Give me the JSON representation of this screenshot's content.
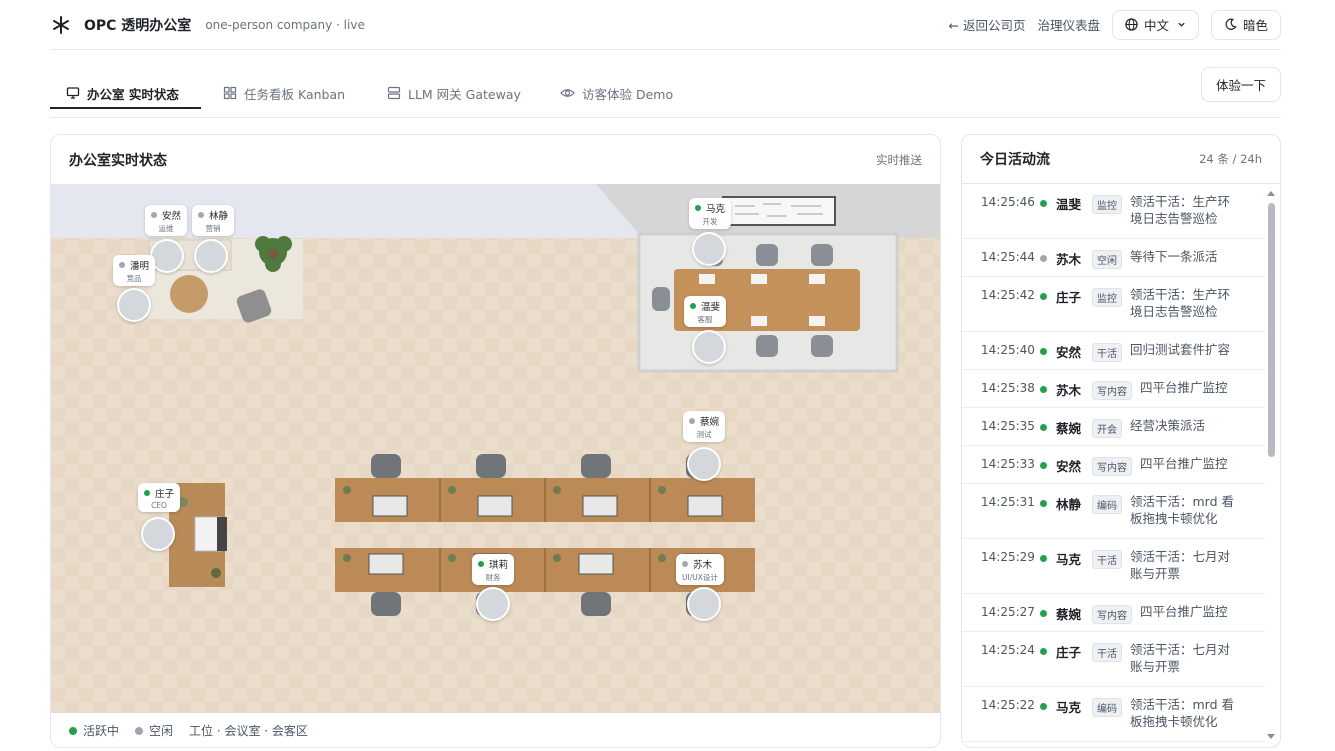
{
  "header": {
    "brand": "OPC 透明办公室",
    "subtitle": "one-person company · live",
    "back_link": "← 返回公司页",
    "governance_link": "治理仪表盘",
    "language": "中文",
    "theme": "暗色"
  },
  "tabs": [
    {
      "label": "办公室  实时状态",
      "icon": "monitor-icon"
    },
    {
      "label": "任务看板  Kanban",
      "icon": "grid-icon"
    },
    {
      "label": "LLM 网关  Gateway",
      "icon": "server-icon"
    },
    {
      "label": "访客体验  Demo",
      "icon": "eye-icon"
    }
  ],
  "try_button": "体验一下",
  "office": {
    "title": "办公室实时状态",
    "tag": "实时推送",
    "legend": {
      "active": "活跃中",
      "idle": "空闲",
      "areas": "工位 · 会议室 · 会客区"
    },
    "people": [
      {
        "name": "安然",
        "role": "运维",
        "status": "idle"
      },
      {
        "name": "林静",
        "role": "营销",
        "status": "idle"
      },
      {
        "name": "潘明",
        "role": "竞品",
        "status": "idle"
      },
      {
        "name": "马克",
        "role": "开发",
        "status": "active"
      },
      {
        "name": "温斐",
        "role": "客服",
        "status": "active"
      },
      {
        "name": "蔡婉",
        "role": "测试",
        "status": "idle"
      },
      {
        "name": "庄子",
        "role": "CEO",
        "status": "active"
      },
      {
        "name": "琪莉",
        "role": "财务",
        "status": "active"
      },
      {
        "name": "苏木",
        "role": "UI/UX设计",
        "status": "idle"
      }
    ]
  },
  "activity": {
    "title": "今日活动流",
    "count": "24 条 / 24h",
    "items": [
      {
        "time": "14:25:46",
        "status": "active",
        "name": "温斐",
        "badge": "监控",
        "text": "领活干活：生产环境日志告警巡检"
      },
      {
        "time": "14:25:44",
        "status": "idle",
        "name": "苏木",
        "badge": "空闲",
        "text": "等待下一条派活"
      },
      {
        "time": "14:25:42",
        "status": "active",
        "name": "庄子",
        "badge": "监控",
        "text": "领活干活：生产环境日志告警巡检"
      },
      {
        "time": "14:25:40",
        "status": "active",
        "name": "安然",
        "badge": "干活",
        "text": "回归测试套件扩容"
      },
      {
        "time": "14:25:38",
        "status": "active",
        "name": "苏木",
        "badge": "写内容",
        "text": "四平台推广监控"
      },
      {
        "time": "14:25:35",
        "status": "active",
        "name": "蔡婉",
        "badge": "开会",
        "text": "经营决策派活"
      },
      {
        "time": "14:25:33",
        "status": "active",
        "name": "安然",
        "badge": "写内容",
        "text": "四平台推广监控"
      },
      {
        "time": "14:25:31",
        "status": "active",
        "name": "林静",
        "badge": "编码",
        "text": "领活干活：mrd 看板拖拽卡顿优化"
      },
      {
        "time": "14:25:29",
        "status": "active",
        "name": "马克",
        "badge": "干活",
        "text": "领活干活：七月对账与开票"
      },
      {
        "time": "14:25:27",
        "status": "active",
        "name": "蔡婉",
        "badge": "写内容",
        "text": "四平台推广监控"
      },
      {
        "time": "14:25:24",
        "status": "active",
        "name": "庄子",
        "badge": "干活",
        "text": "领活干活：七月对账与开票"
      },
      {
        "time": "14:25:22",
        "status": "active",
        "name": "马克",
        "badge": "编码",
        "text": "领活干活：mrd 看板拖拽卡顿优化"
      }
    ]
  },
  "colors": {
    "active": "#22a04b",
    "idle": "#a1a7b0",
    "accent": "#1f2328"
  }
}
